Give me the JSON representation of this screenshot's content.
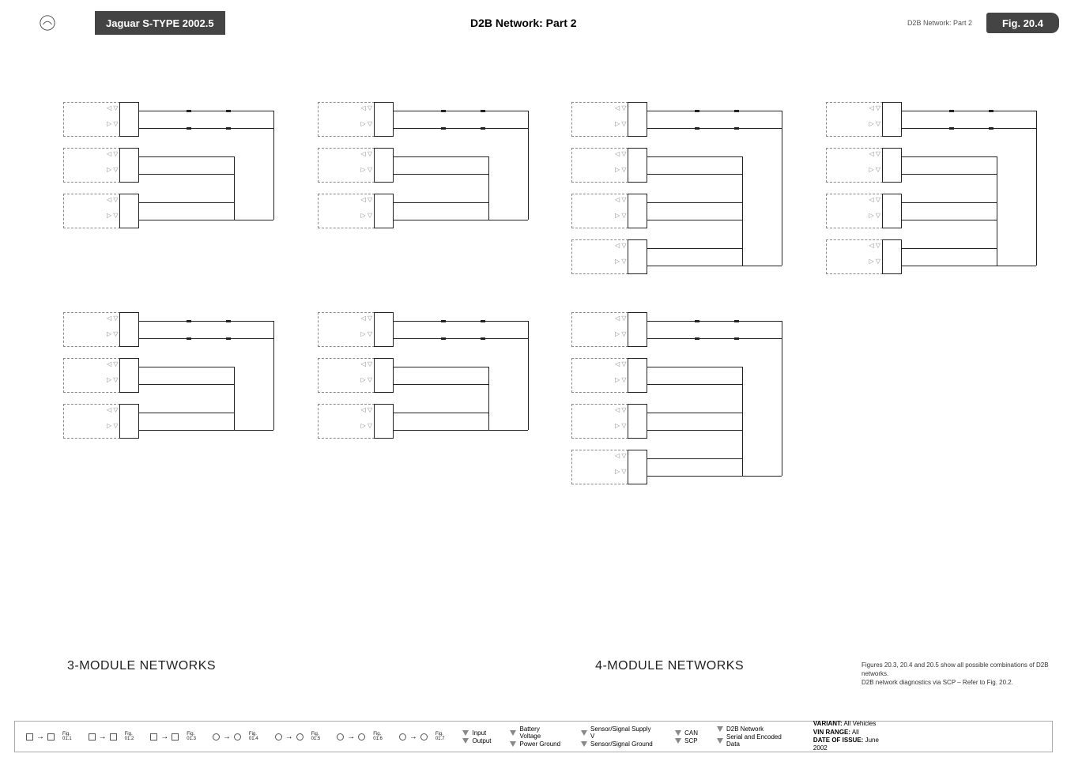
{
  "header": {
    "title": "Jaguar S-TYPE 2002.5",
    "center": "D2B Network: Part 2",
    "right_label": "D2B Network: Part 2",
    "fig": "Fig. 20.4"
  },
  "sections": {
    "left": "3-MODULE NETWORKS",
    "right": "4-MODULE NETWORKS"
  },
  "notes": {
    "line1": "Figures 20.3, 20.4 and 20.5 show all possible combinations of D2B networks.",
    "line2": "D2B network diagnostics via SCP – Refer to Fig. 20.2."
  },
  "footer": {
    "figrefs": [
      "Fig. 01.1",
      "Fig. 01.2",
      "Fig. 01.3",
      "Fig. 01.4",
      "Fig. 01.5",
      "Fig. 01.6",
      "Fig. 01.7"
    ],
    "legend": {
      "input": "Input",
      "output": "Output",
      "battery": "Battery Voltage",
      "power_ground": "Power Ground",
      "sig_supply": "Sensor/Signal Supply V",
      "sig_ground": "Sensor/Signal Ground",
      "can": "CAN",
      "scp": "SCP",
      "d2b": "D2B Network",
      "serial": "Serial and Encoded Data"
    },
    "meta": {
      "variant_k": "VARIANT:",
      "variant_v": "All Vehicles",
      "vin_k": "VIN RANGE:",
      "vin_v": "All",
      "date_k": "DATE OF ISSUE:",
      "date_v": "June 2002"
    }
  },
  "chart_data": {
    "type": "table",
    "title": "D2B Network Module Combinations",
    "columns": [
      {
        "id": 0,
        "network_size": 3,
        "stacks": 2,
        "modules": [
          3,
          3
        ]
      },
      {
        "id": 1,
        "network_size": 3,
        "stacks": 2,
        "modules": [
          3,
          3
        ]
      },
      {
        "id": 2,
        "network_size": 4,
        "stacks": 2,
        "modules": [
          4,
          4
        ]
      },
      {
        "id": 3,
        "network_size": 4,
        "stacks": 1,
        "modules": [
          4
        ]
      }
    ]
  }
}
